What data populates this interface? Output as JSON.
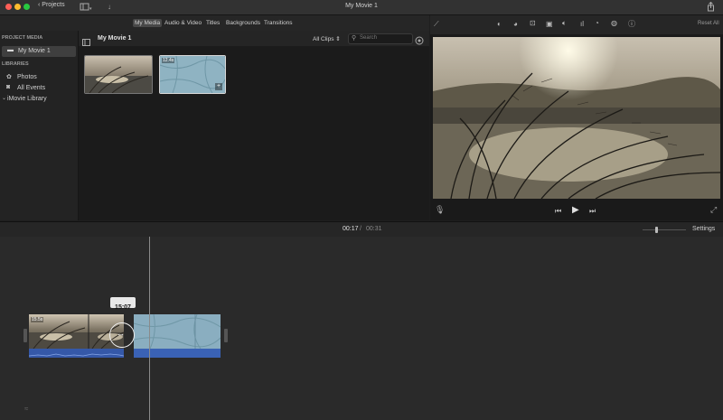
{
  "titlebar": {
    "projects_label": "Projects",
    "window_title": "My Movie 1"
  },
  "media_tabs": [
    "My Media",
    "Audio & Video",
    "Titles",
    "Backgrounds",
    "Transitions"
  ],
  "sidebar": {
    "project_media_header": "PROJECT MEDIA",
    "project_item": "My Movie 1",
    "libraries_header": "LIBRARIES",
    "photos": "Photos",
    "all_events": "All Events",
    "imovie_library": "iMovie Library"
  },
  "browser": {
    "title": "My Movie 1",
    "filter": "All Clips",
    "search_placeholder": "Search",
    "clip2_duration": "12.4s"
  },
  "viewer": {
    "reset_all": "Reset All"
  },
  "timeline": {
    "current_time": "00:17",
    "separator": "/",
    "total_time": "00:31",
    "settings": "Settings",
    "tooltip_time": "15:07",
    "clip1_duration": "15.5s"
  },
  "colors": {
    "accent_blue": "#3a62b5",
    "selected_item": "#3f3f3f"
  }
}
